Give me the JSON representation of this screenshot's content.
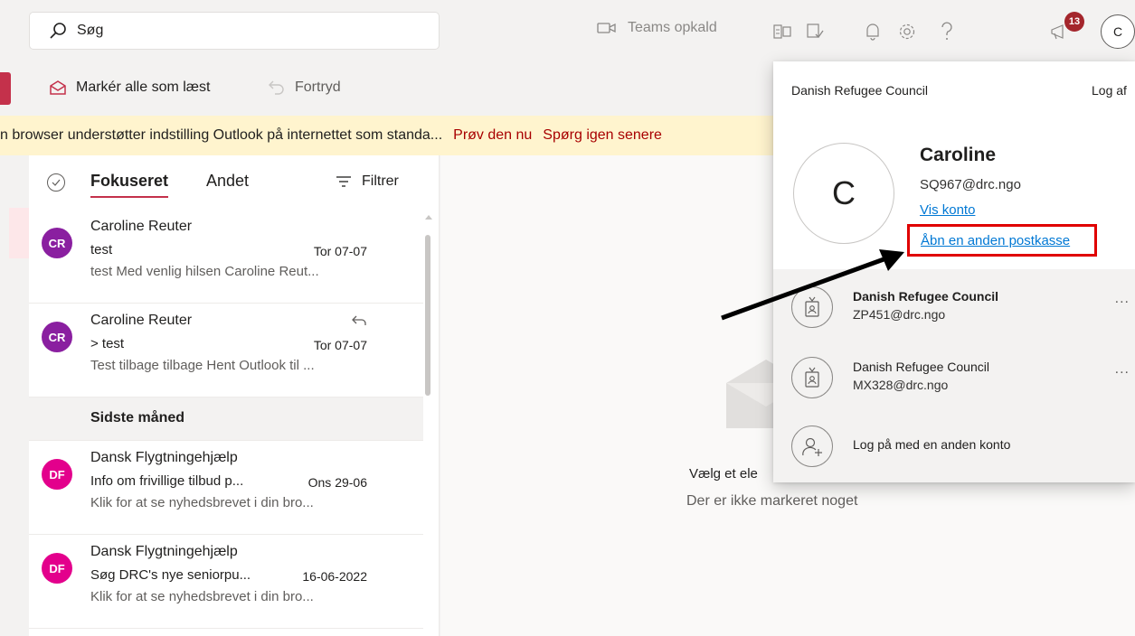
{
  "header": {
    "search_placeholder": "Søg",
    "teams_call_label": "Teams opkald",
    "notification_count": "13",
    "avatar_initial": "C"
  },
  "commands": {
    "mark_all_read": "Markér alle som læst",
    "undo": "Fortryd"
  },
  "banner": {
    "message": "n browser understøtter indstilling Outlook på internettet som standa...",
    "try_now": "Prøv den nu",
    "ask_later": "Spørg igen senere"
  },
  "list": {
    "tab_focused": "Fokuseret",
    "tab_other": "Andet",
    "filter_label": "Filtrer",
    "section_last_month": "Sidste måned",
    "messages": [
      {
        "initials": "CR",
        "color": "#8a1fa0",
        "from": "Caroline Reuter",
        "subject": "test",
        "date": "Tor 07-07",
        "preview": "test Med venlig hilsen Caroline Reut..."
      },
      {
        "initials": "CR",
        "color": "#8a1fa0",
        "from": "Caroline Reuter",
        "subject": "> test",
        "date": "Tor 07-07",
        "preview": "Test tilbage tilbage Hent Outlook til ..."
      },
      {
        "initials": "DF",
        "color": "#e3008c",
        "from": "Dansk Flygtningehjælp",
        "subject": "Info om frivillige tilbud p...",
        "date": "Ons 29-06",
        "preview": "Klik for at se nyhedsbrevet i din bro..."
      },
      {
        "initials": "DF",
        "color": "#e3008c",
        "from": "Dansk Flygtningehjælp",
        "subject": "Søg DRC's nye seniorpu...",
        "date": "16-06-2022",
        "preview": "Klik for at se nyhedsbrevet i din bro..."
      }
    ]
  },
  "reading": {
    "empty_title": "Vælg et ele",
    "empty_sub": "Der er ikke markeret noget"
  },
  "popup": {
    "org": "Danish Refugee Council",
    "logout": "Log af",
    "avatar_initial": "C",
    "name": "Caroline",
    "email": "SQ967@drc.ngo",
    "view_account": "Vis konto",
    "open_other_mailbox": "Åbn en anden postkasse",
    "accounts": [
      {
        "name": "Danish Refugee Council",
        "email": "ZP451@drc.ngo",
        "more": "..."
      },
      {
        "name": "Danish Refugee Council",
        "email": "MX328@drc.ngo",
        "more": "..."
      }
    ],
    "sign_in_other": "Log på med en anden konto"
  },
  "colors": {
    "accent": "#c4314b",
    "link": "#0078d4",
    "highlight_box": "#e00000"
  }
}
